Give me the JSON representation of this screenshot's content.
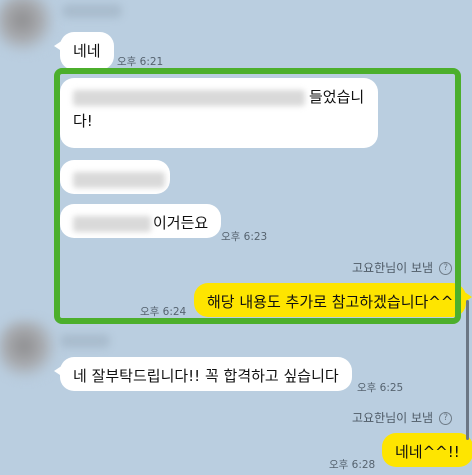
{
  "messages": {
    "m1": {
      "text": "네네",
      "time": "오후 6:21"
    },
    "m2": {
      "text_line1_suffix": "들었습니",
      "text_line2": "다!"
    },
    "m4": {
      "text_suffix": "이거든요",
      "time": "오후 6:23"
    },
    "sender_label_1": "고요한님이 보냄",
    "m5": {
      "text": "해당 내용도 추가로 참고하겠습니다^^",
      "time": "오후 6:24"
    },
    "m6": {
      "text": "네 잘부탁드립니다!! 꼭 합격하고 싶습니다",
      "time": "오후 6:25"
    },
    "sender_label_2": "고요한님이 보냄",
    "m7": {
      "text": "네네^^!!",
      "time": "오후 6:28"
    }
  },
  "icons": {
    "help": "?"
  },
  "colors": {
    "background": "#bacee0",
    "my_bubble": "#fee500",
    "their_bubble": "#ffffff",
    "highlight": "#4caf2c"
  }
}
